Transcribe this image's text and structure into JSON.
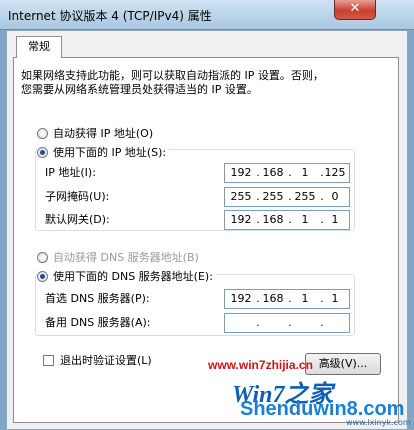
{
  "window": {
    "title": "Internet 协议版本 4 (TCP/IPv4) 属性",
    "close_label": "✕"
  },
  "tabs": [
    {
      "label": "常规",
      "selected": true
    }
  ],
  "description": [
    "如果网络支持此功能，则可以获取自动指派的 IP 设置。否则，",
    "您需要从网络系统管理员处获得适当的 IP 设置。"
  ],
  "ip_section": {
    "auto_label": "自动获得 IP 地址(O)",
    "manual_label": "使用下面的 IP 地址(S):",
    "manual_selected": true,
    "fields": [
      {
        "label": "IP 地址(I):",
        "octets": [
          "192",
          "168",
          "1",
          "125"
        ]
      },
      {
        "label": "子网掩码(U):",
        "octets": [
          "255",
          "255",
          "255",
          "0"
        ]
      },
      {
        "label": "默认网关(D):",
        "octets": [
          "192",
          "168",
          "1",
          "1"
        ]
      }
    ]
  },
  "dns_section": {
    "auto_label": "自动获得 DNS 服务器地址(B)",
    "manual_label": "使用下面的 DNS 服务器地址(E):",
    "manual_selected": true,
    "fields": [
      {
        "label": "首选 DNS 服务器(P):",
        "octets": [
          "192",
          "168",
          "1",
          "1"
        ]
      },
      {
        "label": "备用 DNS 服务器(A):",
        "octets": [
          "",
          "",
          "",
          ""
        ]
      }
    ]
  },
  "validate_on_exit": {
    "label": "退出时验证设置(L)",
    "checked": false
  },
  "advanced_button": "高级(V)...",
  "watermark": {
    "url": "www.win7zhijia.cn",
    "logo": "Win7之家",
    "brand": "Shenduwin8.com",
    "site": "www.lxinyk.com"
  }
}
